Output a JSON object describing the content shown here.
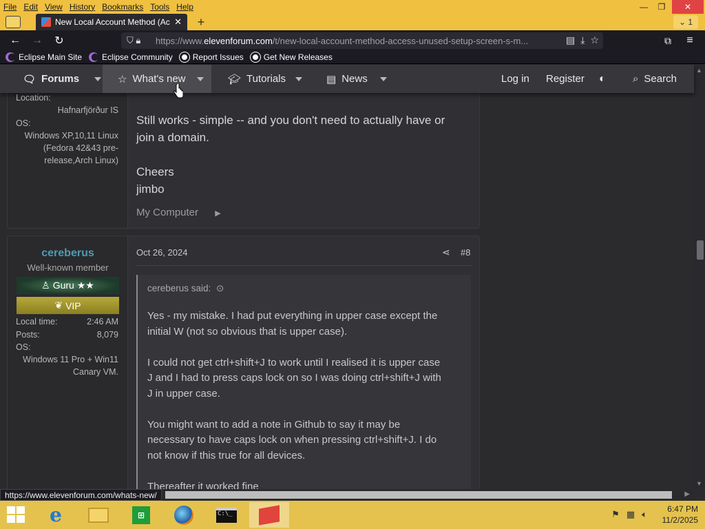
{
  "menubar": {
    "items": [
      "File",
      "Edit",
      "View",
      "History",
      "Bookmarks",
      "Tools",
      "Help"
    ]
  },
  "tabs": {
    "active_title": "New Local Account Method (Ac",
    "count": "1"
  },
  "urlbar": {
    "prefix": "https://www.",
    "domain": "elevenforum.com",
    "path": "/t/new-local-account-method-access-unused-setup-screen-s-m..."
  },
  "bookmarks": [
    {
      "label": "Eclipse Main Site",
      "icon": "eclipse-icon"
    },
    {
      "label": "Eclipse Community",
      "icon": "eclipse-icon"
    },
    {
      "label": "Report Issues",
      "icon": "github-icon"
    },
    {
      "label": "Get New Releases",
      "icon": "github-icon"
    }
  ],
  "site_nav": {
    "forums": "Forums",
    "whats_new": "What's new",
    "tutorials": "Tutorials",
    "news": "News",
    "login": "Log in",
    "register": "Register",
    "search": "Search"
  },
  "post_prev": {
    "location_label": "Location:",
    "location_value": "Hafnarfjörður IS",
    "os_label": "OS:",
    "os_value": [
      "Windows XP,10,11 Linux",
      "(Fedora 42&43 pre-",
      "release,Arch Linux)"
    ],
    "text1_line1": "Still works - simple -- and you don't need to actually have or",
    "text1_line2": "join a domain.",
    "text2_line1": "Cheers",
    "text2_line2": "jimbo",
    "my_computer": "My Computer"
  },
  "post": {
    "username": "cereberus",
    "user_title": "Well-known member",
    "banner_guru": "Guru ★★",
    "banner_vip": "VIP",
    "local_time_label": "Local time:",
    "local_time_value": "2:46 AM",
    "posts_label": "Posts:",
    "posts_value": "8,079",
    "os_label": "OS:",
    "os_value_line1": "Windows 11 Pro + Win11",
    "os_value_line2": "Canary VM.",
    "date": "Oct 26, 2024",
    "number": "#8",
    "quote_author": "cereberus said:",
    "quote_lines": [
      "Yes - my mistake. I had put everything in upper case except the",
      "initial W (not so obvious that is upper case).",
      "",
      "I could not get ctrl+shift+J to work until I realised it is upper case",
      "J and I had to press caps lock on so I was doing ctrl+shift+J with",
      "J in upper case.",
      "",
      "You might want to add a note in Github to say it may be",
      "necessary to have caps lock on when pressing ctrl+shift+J. I do",
      "not know if this true for all devices.",
      "",
      "Thereafter it worked fine"
    ]
  },
  "statusbar": {
    "url": "https://www.elevenforum.com/whats-new/"
  },
  "taskbar": {
    "time": "6:47 PM",
    "date": "11/2/2025",
    "apps": [
      "internet-explorer-icon",
      "file-explorer-icon",
      "store-icon",
      "firefox-icon",
      "command-prompt-icon",
      "app-icon"
    ]
  },
  "colors": {
    "menubar_bg": "#f0c040",
    "site_nav_bg": "#37373b",
    "username": "#4d9cb3"
  }
}
